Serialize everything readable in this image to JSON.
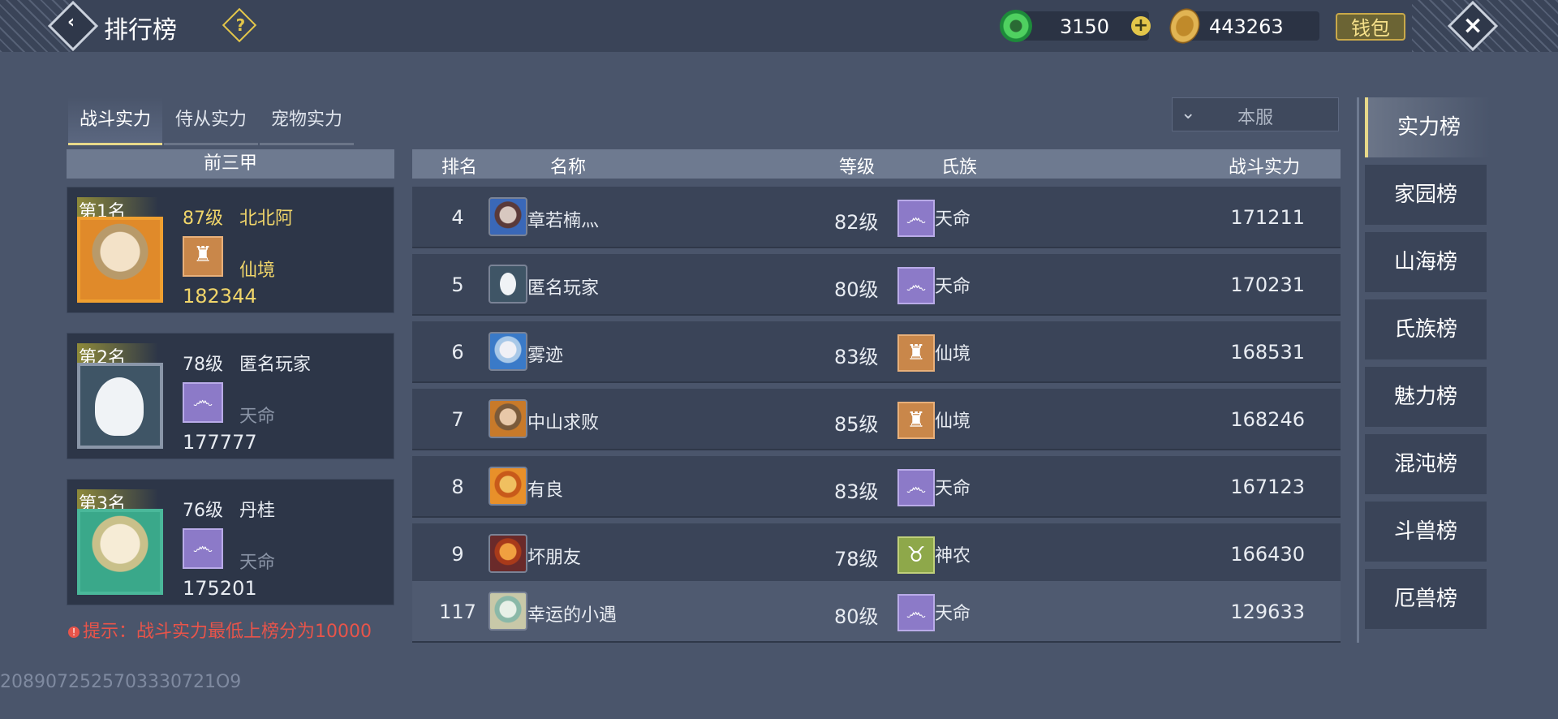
{
  "header": {
    "title": "排行榜",
    "help_label": "?",
    "jade_amount": "3150",
    "gold_amount": "443263",
    "wallet_label": "钱包"
  },
  "tabs": [
    "战斗实力",
    "侍从实力",
    "宠物实力"
  ],
  "server_filter": "本服",
  "top3": {
    "header": "前三甲",
    "entries": [
      {
        "rank": "第1名",
        "level": "87级",
        "name": "北北阿",
        "clan": "仙境",
        "power": "182344"
      },
      {
        "rank": "第2名",
        "level": "78级",
        "name": "匿名玩家",
        "clan": "天命",
        "power": "177777"
      },
      {
        "rank": "第3名",
        "level": "76级",
        "name": "丹桂",
        "clan": "天命",
        "power": "175201"
      }
    ]
  },
  "tip": "提示：战斗实力最低上榜分为10000",
  "table": {
    "headers": {
      "rank": "排名",
      "name": "名称",
      "level": "等级",
      "clan": "氏族",
      "power": "战斗实力"
    },
    "rows": [
      {
        "rank": "4",
        "name": "章若楠灬",
        "level": "82级",
        "clan": "天命",
        "power": "171211"
      },
      {
        "rank": "5",
        "name": "匿名玩家",
        "level": "80级",
        "clan": "天命",
        "power": "170231"
      },
      {
        "rank": "6",
        "name": "雾迹",
        "level": "83级",
        "clan": "仙境",
        "power": "168531"
      },
      {
        "rank": "7",
        "name": "中山求败",
        "level": "85级",
        "clan": "仙境",
        "power": "168246"
      },
      {
        "rank": "8",
        "name": "有良",
        "level": "83级",
        "clan": "天命",
        "power": "167123"
      },
      {
        "rank": "9",
        "name": "坏朋友",
        "level": "78级",
        "clan": "神农",
        "power": "166430"
      }
    ],
    "self_row": {
      "rank": "117",
      "name": "幸运的小遇",
      "level": "80级",
      "clan": "天命",
      "power": "129633"
    }
  },
  "side_menu": [
    "实力榜",
    "家园榜",
    "山海榜",
    "氏族榜",
    "魅力榜",
    "混沌榜",
    "斗兽榜",
    "厄兽榜"
  ],
  "uid": "2089072525703330721O9"
}
